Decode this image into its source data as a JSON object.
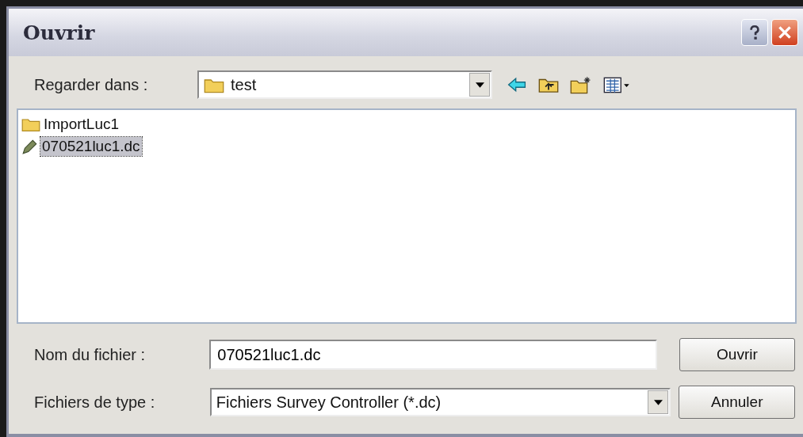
{
  "window": {
    "title": "Ouvrir"
  },
  "look_in": {
    "label": "Regarder dans :",
    "value": "test"
  },
  "files": [
    {
      "name": "ImportLuc1",
      "kind": "folder",
      "selected": false
    },
    {
      "name": "070521luc1.dc",
      "kind": "file",
      "selected": true
    }
  ],
  "file_name": {
    "label": "Nom du fichier :",
    "value": "070521luc1.dc"
  },
  "file_type": {
    "label": "Fichiers de type :",
    "value": "Fichiers Survey Controller (*.dc)"
  },
  "buttons": [
    {
      "label": "Ouvrir"
    },
    {
      "label": "Annuler"
    }
  ]
}
